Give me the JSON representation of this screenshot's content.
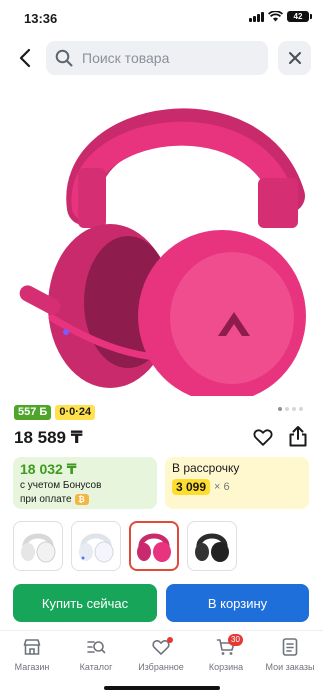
{
  "status_bar": {
    "time": "13:36",
    "battery": "42"
  },
  "search": {
    "placeholder": "Поиск товара",
    "value": ""
  },
  "badges": {
    "bonus": "557 Б",
    "installment": "0·0·24"
  },
  "product": {
    "price": "18 589 ₸",
    "image_colors": {
      "main": "#e8337f",
      "dark": "#b41f5e",
      "light": "#f56aa3"
    }
  },
  "bonus_card": {
    "price": "18 032 ₸",
    "note_line1": "с учетом Бонусов",
    "note_line2": "при оплате"
  },
  "installment_card": {
    "title": "В рассрочку",
    "amount": "3 099",
    "multiplier": "× 6"
  },
  "variants": [
    {
      "name": "white",
      "color": "#f2f2f2",
      "selected": false
    },
    {
      "name": "white-blue",
      "color": "#f4f6fb",
      "selected": false
    },
    {
      "name": "pink",
      "color": "#e8337f",
      "selected": true
    },
    {
      "name": "black",
      "color": "#222222",
      "selected": false
    }
  ],
  "actions": {
    "buy_now": "Купить сейчас",
    "add_to_cart": "В корзину"
  },
  "tabbar": {
    "items": [
      {
        "label": "Магазин",
        "icon": "store-icon"
      },
      {
        "label": "Каталог",
        "icon": "catalog-search-icon"
      },
      {
        "label": "Избранное",
        "icon": "heart-icon"
      },
      {
        "label": "Корзина",
        "icon": "cart-icon",
        "badge": "30"
      },
      {
        "label": "Мои заказы",
        "icon": "orders-icon"
      }
    ]
  },
  "colors": {
    "green": "#17a55a",
    "blue": "#1e6fd9",
    "bonus_green": "#4fa529",
    "installment_yellow": "#ffdd2d",
    "accent_red": "#e53935"
  }
}
